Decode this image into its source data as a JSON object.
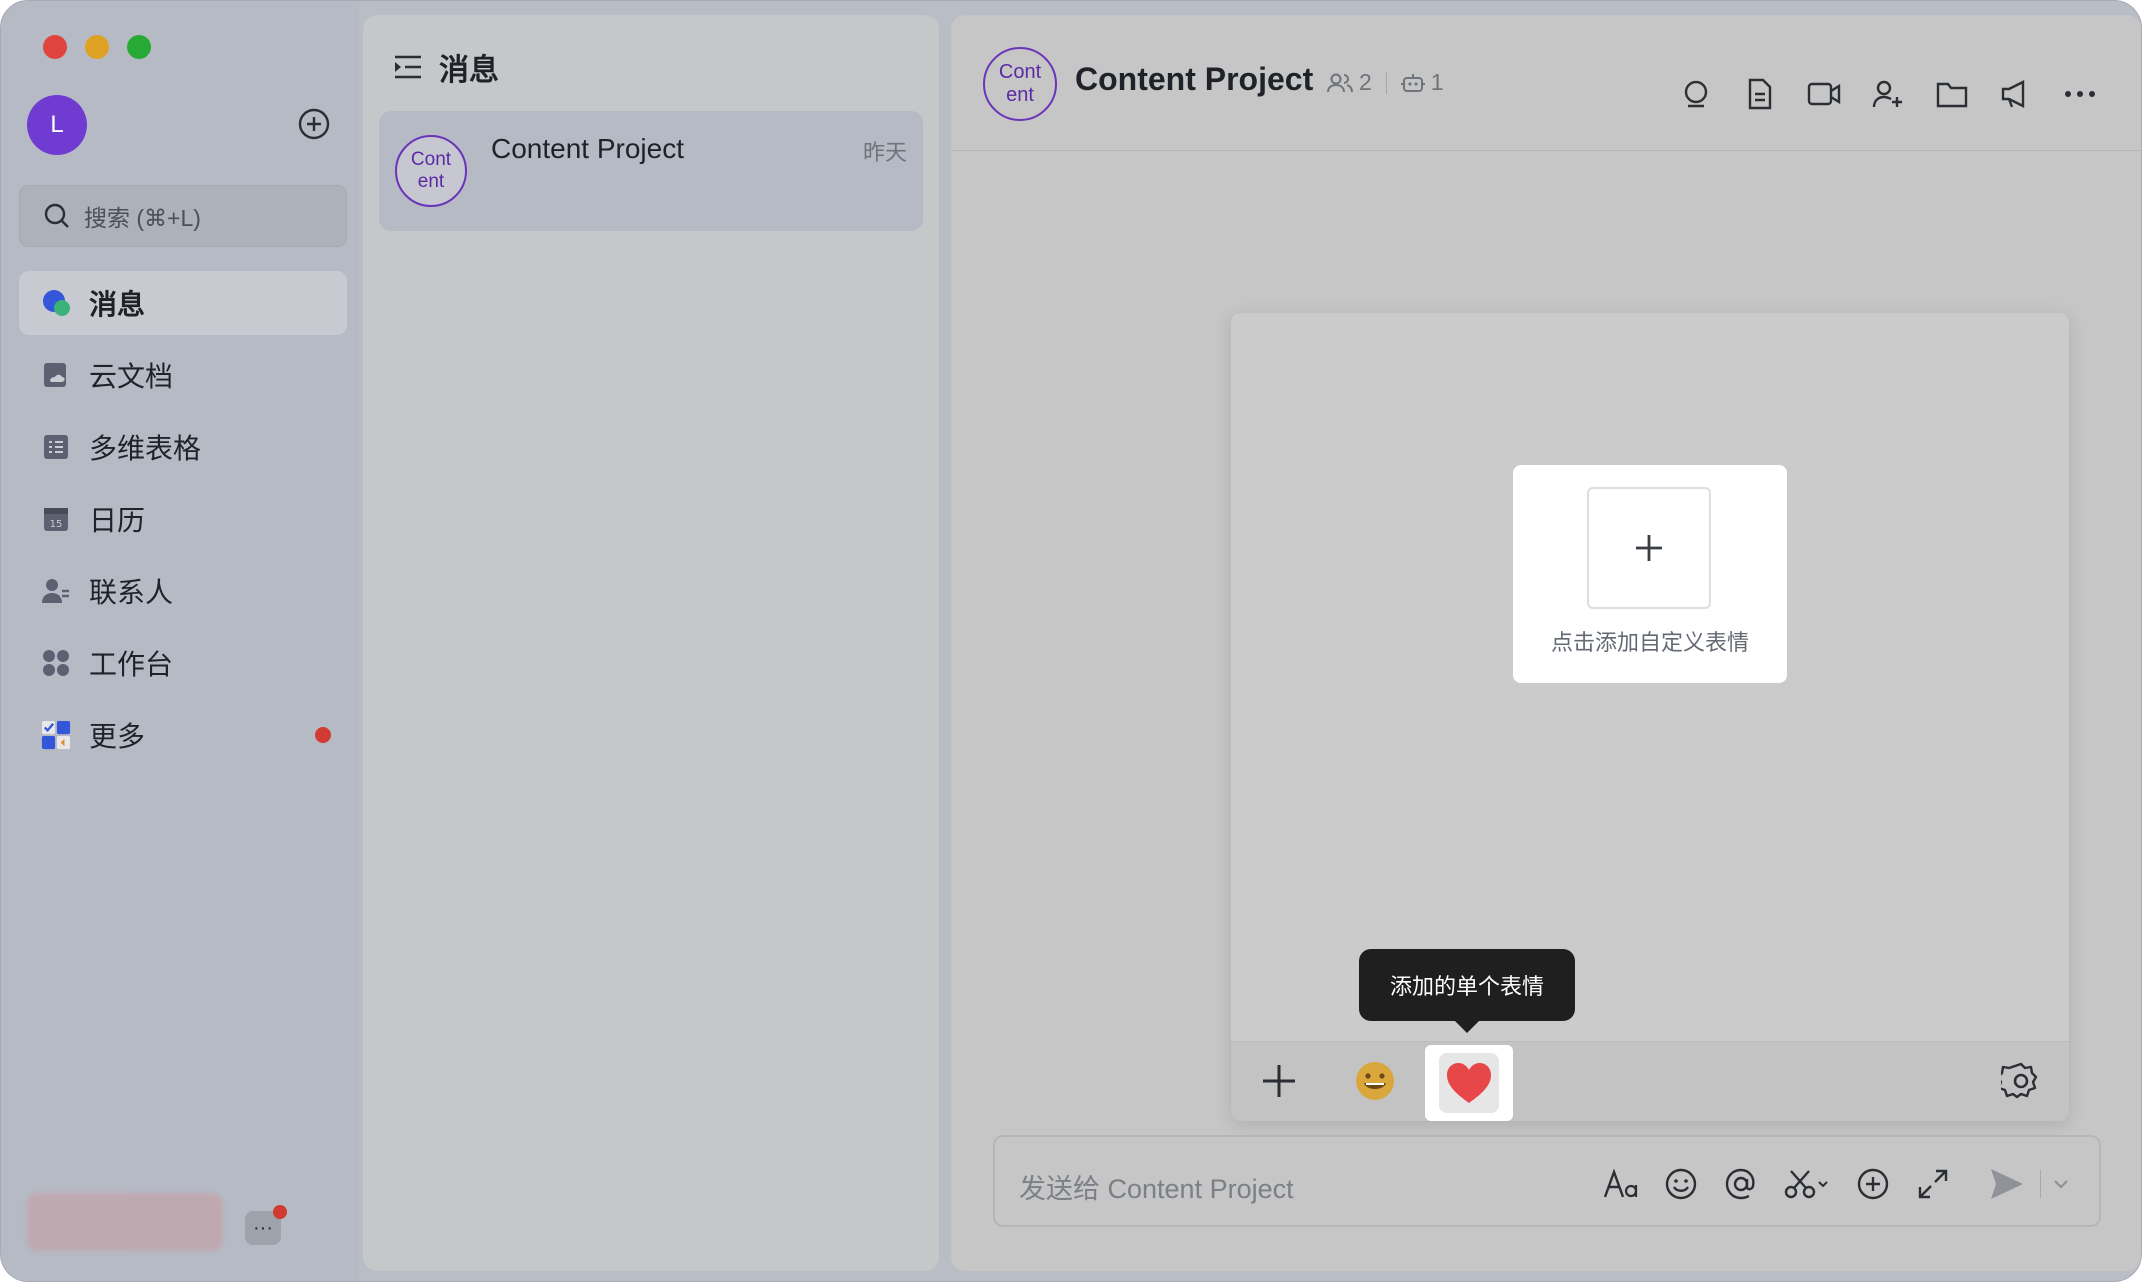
{
  "sidebar": {
    "user_initial": "L",
    "search_placeholder": "搜索 (⌘+L)",
    "items": [
      {
        "label": "消息",
        "icon": "message-icon",
        "active": true
      },
      {
        "label": "云文档",
        "icon": "cloud-doc-icon"
      },
      {
        "label": "多维表格",
        "icon": "base-table-icon"
      },
      {
        "label": "日历",
        "icon": "calendar-icon"
      },
      {
        "label": "联系人",
        "icon": "contacts-icon"
      },
      {
        "label": "工作台",
        "icon": "workplace-icon"
      },
      {
        "label": "更多",
        "icon": "more-apps-icon",
        "badge": true
      }
    ],
    "more_mini_label": "···"
  },
  "list": {
    "title": "消息",
    "conversations": [
      {
        "avatar_text": "Cont ent",
        "name": "Content Project",
        "time": "昨天"
      }
    ]
  },
  "chat": {
    "avatar_text": "Cont ent",
    "title": "Content Project",
    "members": "2",
    "bots": "1",
    "input_placeholder": "发送给 Content Project"
  },
  "stickers": {
    "add_custom_label": "点击添加自定义表情",
    "tooltip": "添加的单个表情"
  },
  "colors": {
    "accent_purple": "#6f3bd1",
    "badge_red": "#d23b31",
    "heart_red": "#e8474a"
  }
}
